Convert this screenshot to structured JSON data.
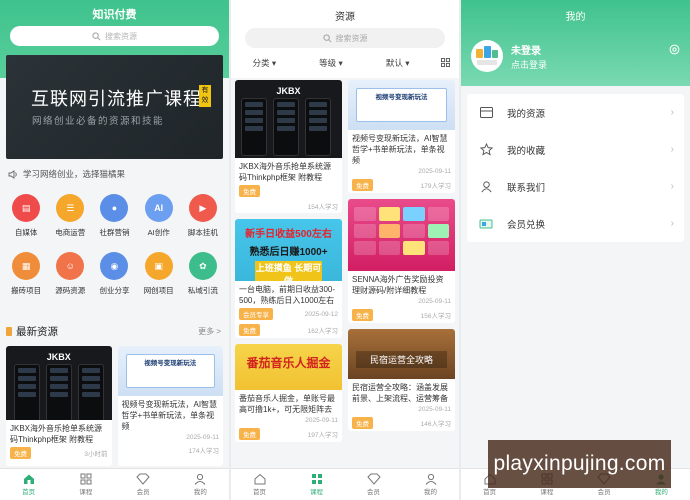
{
  "home": {
    "title": "知识付费",
    "search_placeholder": "搜索资源",
    "banner": {
      "title": "互联网引流推广课程",
      "tag": "有效",
      "subtitle": "网络创业必备的资源和技能"
    },
    "notice": "学习网络创业，选择猫橘果",
    "categories": [
      {
        "label": "自媒体",
        "icon": "media-icon",
        "color": "#f04b4b"
      },
      {
        "label": "电商运营",
        "icon": "shop-icon",
        "color": "#f4a72b"
      },
      {
        "label": "社群营销",
        "icon": "group-icon",
        "color": "#5b8ee6"
      },
      {
        "label": "AI创作",
        "icon": "ai-icon",
        "color": "#6c9ff0"
      },
      {
        "label": "脚本挂机",
        "icon": "script-icon",
        "color": "#ef5a4c"
      },
      {
        "label": "搬砖项目",
        "icon": "brick-icon",
        "color": "#f08d3a"
      },
      {
        "label": "源码资源",
        "icon": "code-icon",
        "color": "#f0734a"
      },
      {
        "label": "创业分享",
        "icon": "share-icon",
        "color": "#5b8ee6"
      },
      {
        "label": "网创项目",
        "icon": "project-icon",
        "color": "#f4a72b"
      },
      {
        "label": "私域引流",
        "icon": "flow-icon",
        "color": "#3dbd8c"
      }
    ],
    "latest": {
      "title": "最新资源",
      "more": "更多 >"
    },
    "cards": [
      {
        "title": "JKBX海外音乐抢单系统源码Thinkphp框架 附教程",
        "tag": "免费",
        "date": "3小时前",
        "thumb": "JKBX"
      },
      {
        "title": "视频号变现新玩法，AI智慧哲学+书单新玩法，单条视频",
        "date": "2025-09-11",
        "views": "174人学习",
        "thumb": "视频号变现新玩法"
      }
    ],
    "tabs": [
      {
        "label": "首页",
        "icon": "home-icon"
      },
      {
        "label": "课程",
        "icon": "course-icon"
      },
      {
        "label": "会员",
        "icon": "vip-icon"
      },
      {
        "label": "我的",
        "icon": "user-icon"
      }
    ]
  },
  "resources": {
    "title": "资源",
    "search_placeholder": "搜索资源",
    "filters": [
      "分类",
      "等级",
      "默认"
    ],
    "left": [
      {
        "thumb": "JKBX",
        "title": "JKBX海外音乐抢单系统源码Thinkphp框架 附教程",
        "tag": "免费",
        "views": "154人学习"
      },
      {
        "thumb_lines": [
          "新手日收益500左右",
          "熟悉后日赚1000+",
          "上班摸鱼 长期可做"
        ],
        "title": "一台电脑，前期日收益300-500，熟练后日入1000左右",
        "tag": "会员专享",
        "date": "2025-09-12",
        "free": "免费",
        "views": "162人学习"
      },
      {
        "thumb_lines": [
          "番茄音乐人掘金"
        ],
        "title": "番茄音乐人掘金，单账号最高可撸1k+，可无限矩阵去",
        "date": "2025-09-11",
        "free": "免费",
        "views": "197人学习"
      }
    ],
    "right": [
      {
        "thumb": "视频号变现新玩法",
        "title": "视频号变现新玩法，AI智慧哲学+书单新玩法，单条视频",
        "date": "2025-09-11",
        "tag": "免费",
        "views": "179人学习"
      },
      {
        "title": "SENNA海外广告奖励投资理财源码/附详细教程",
        "date": "2025-09-11",
        "tag": "免费",
        "views": "156人学习"
      },
      {
        "thumb_lines": [
          "民宿运营全攻略"
        ],
        "title": "民宿运营全攻略：涵盖发展前景、上架流程、运营筹备",
        "date": "2025-09-11",
        "free": "免费",
        "views": "146人学习"
      }
    ]
  },
  "mine": {
    "title": "我的",
    "user": {
      "name": "未登录",
      "action": "点击登录"
    },
    "menu": [
      {
        "label": "我的资源",
        "icon": "resource-icon"
      },
      {
        "label": "我的收藏",
        "icon": "star-icon"
      },
      {
        "label": "联系我们",
        "icon": "contact-icon"
      },
      {
        "label": "会员兑换",
        "icon": "exchange-icon"
      }
    ]
  },
  "watermark": "playxinpujing.com",
  "colors": {
    "brand": "#3fc28d",
    "tag": "#f7b24a",
    "tab_active": "#2fae77"
  }
}
